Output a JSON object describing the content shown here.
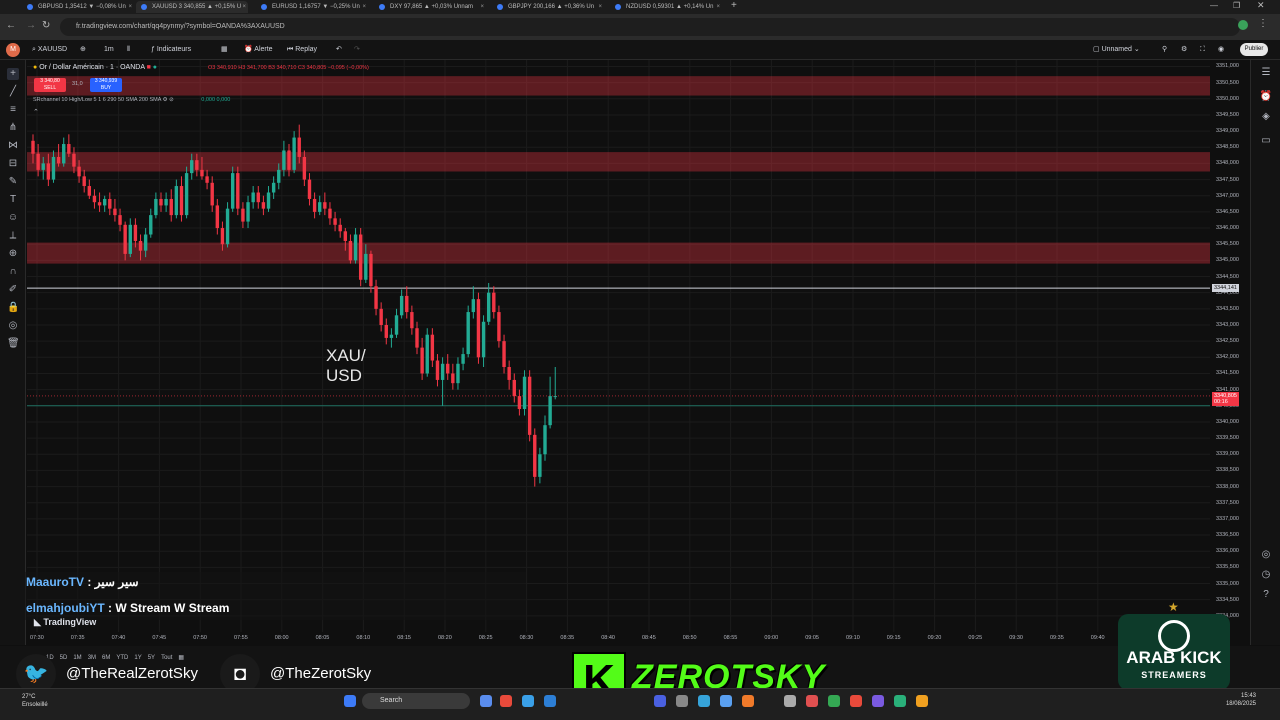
{
  "browser": {
    "tabs": [
      {
        "label": "GBPUSD 1,35412 ▼ −0,08% Un",
        "active": false
      },
      {
        "label": "XAUUSD 3 340,855 ▲ +0,15% U",
        "active": true
      },
      {
        "label": "EURUSD 1,16757 ▼ −0,25% Un",
        "active": false
      },
      {
        "label": "DXY 97,865 ▲ +0,03% Unnam",
        "active": false
      },
      {
        "label": "GBPJPY 200,166 ▲ +0,36% Un",
        "active": false
      },
      {
        "label": "NZDUSD 0,59301 ▲ +0,14% Un",
        "active": false
      }
    ],
    "new_tab": "+",
    "url": "fr.tradingview.com/chart/qq4pynmy/?symbol=OANDA%3AXAUUSD"
  },
  "header": {
    "symbol": "XAUUSD",
    "interval": "1m",
    "indicators": "Indicateurs",
    "alert": "Alerte",
    "replay": "Replay",
    "layout_name": "Unnamed",
    "publish": "Publier"
  },
  "legend": {
    "title": "Or / Dollar Américain · 1 · OANDA",
    "ohlc": "O3 340,910 H3 341,700 B3 340,710 C3 340,805 −0,095 (−0,00%)",
    "sell_price": "3 340,80",
    "sell_label": "SELL",
    "spread": "31,0",
    "buy_price": "3 340,939",
    "buy_label": "BUY",
    "indicator": "SRchannel 10 High/Low 5 1 6 290 50 SMA 200 SMA",
    "indicator_values": "0,000  0,000"
  },
  "overlay_title": {
    "line1": "XAU/",
    "line2": "USD"
  },
  "price_ticks": [
    "3351,000",
    "3350,500",
    "3350,000",
    "3349,500",
    "3349,000",
    "3348,500",
    "3348,000",
    "3347,500",
    "3347,000",
    "3346,500",
    "3346,000",
    "3345,500",
    "3345,000",
    "3344,500",
    "3344,000",
    "3343,500",
    "3343,000",
    "3342,500",
    "3342,000",
    "3341,500",
    "3341,000",
    "3340,500",
    "3340,000",
    "3339,500",
    "3339,000",
    "3338,500",
    "3338,000",
    "3337,500",
    "3337,000",
    "3336,500",
    "3336,000",
    "3335,500",
    "3335,000",
    "3334,500",
    "3334,000"
  ],
  "price_labels": {
    "crosshair": "3344,141",
    "last": "3340,805",
    "countdown": "00:16"
  },
  "time_ticks": [
    "07:30",
    "07:35",
    "07:40",
    "07:45",
    "07:50",
    "07:55",
    "08:00",
    "08:05",
    "08:10",
    "08:15",
    "08:20",
    "08:25",
    "08:30",
    "08:35",
    "08:40",
    "08:45",
    "08:50",
    "08:55",
    "09:00",
    "09:05",
    "09:10",
    "09:15",
    "09:20",
    "09:25",
    "09:30",
    "09:35",
    "09:40"
  ],
  "chart_data": {
    "type": "candlestick",
    "ylim": [
      3333.5,
      3351.2
    ],
    "up_color": "#22ab94",
    "down_color": "#f23645",
    "zones": [
      [
        3350.1,
        3350.7
      ],
      [
        3347.75,
        3348.35
      ],
      [
        3344.9,
        3345.55
      ]
    ],
    "hlines": [
      3344.141,
      3340.5
    ],
    "last_price": 3340.805,
    "candles": [
      [
        3348.7,
        3348.9,
        3348.0,
        3348.3
      ],
      [
        3348.3,
        3348.6,
        3347.6,
        3347.8
      ],
      [
        3347.8,
        3348.2,
        3347.5,
        3348.0
      ],
      [
        3348.0,
        3348.3,
        3347.3,
        3347.5
      ],
      [
        3347.5,
        3348.4,
        3347.4,
        3348.2
      ],
      [
        3348.2,
        3348.6,
        3347.9,
        3348.0
      ],
      [
        3348.0,
        3348.8,
        3347.9,
        3348.6
      ],
      [
        3348.6,
        3348.9,
        3348.2,
        3348.3
      ],
      [
        3348.3,
        3348.5,
        3347.7,
        3347.9
      ],
      [
        3347.9,
        3348.1,
        3347.4,
        3347.6
      ],
      [
        3347.6,
        3347.8,
        3347.1,
        3347.3
      ],
      [
        3347.3,
        3347.5,
        3346.9,
        3347.0
      ],
      [
        3347.0,
        3347.2,
        3346.6,
        3346.8
      ],
      [
        3346.8,
        3347.1,
        3346.5,
        3346.7
      ],
      [
        3346.7,
        3347.0,
        3346.5,
        3346.9
      ],
      [
        3346.9,
        3347.1,
        3346.4,
        3346.6
      ],
      [
        3346.6,
        3346.9,
        3346.2,
        3346.4
      ],
      [
        3346.4,
        3346.6,
        3345.9,
        3346.1
      ],
      [
        3346.1,
        3346.2,
        3345.0,
        3345.2
      ],
      [
        3345.2,
        3346.3,
        3345.1,
        3346.1
      ],
      [
        3346.1,
        3346.3,
        3345.4,
        3345.6
      ],
      [
        3345.6,
        3345.8,
        3345.0,
        3345.3
      ],
      [
        3345.3,
        3346.0,
        3345.1,
        3345.8
      ],
      [
        3345.8,
        3346.6,
        3345.7,
        3346.4
      ],
      [
        3346.4,
        3347.1,
        3346.3,
        3346.9
      ],
      [
        3346.9,
        3347.1,
        3346.5,
        3346.7
      ],
      [
        3346.7,
        3347.1,
        3346.5,
        3346.9
      ],
      [
        3346.9,
        3347.2,
        3346.2,
        3346.4
      ],
      [
        3346.4,
        3347.5,
        3346.3,
        3347.3
      ],
      [
        3347.3,
        3347.6,
        3346.2,
        3346.4
      ],
      [
        3346.4,
        3347.9,
        3346.3,
        3347.7
      ],
      [
        3347.7,
        3348.3,
        3347.5,
        3348.1
      ],
      [
        3348.1,
        3348.3,
        3347.6,
        3347.8
      ],
      [
        3347.8,
        3348.2,
        3347.5,
        3347.6
      ],
      [
        3347.6,
        3347.8,
        3347.2,
        3347.4
      ],
      [
        3347.4,
        3347.6,
        3346.5,
        3346.7
      ],
      [
        3346.7,
        3346.9,
        3345.8,
        3346.0
      ],
      [
        3346.0,
        3346.2,
        3345.3,
        3345.5
      ],
      [
        3345.5,
        3346.8,
        3345.4,
        3346.6
      ],
      [
        3346.6,
        3347.9,
        3346.5,
        3347.7
      ],
      [
        3347.7,
        3347.9,
        3346.4,
        3346.6
      ],
      [
        3346.6,
        3346.8,
        3346.0,
        3346.2
      ],
      [
        3346.2,
        3347.0,
        3346.0,
        3346.8
      ],
      [
        3346.8,
        3347.3,
        3346.6,
        3347.1
      ],
      [
        3347.1,
        3347.3,
        3346.6,
        3346.8
      ],
      [
        3346.8,
        3347.0,
        3346.4,
        3346.6
      ],
      [
        3346.6,
        3347.3,
        3346.5,
        3347.1
      ],
      [
        3347.1,
        3347.6,
        3346.9,
        3347.4
      ],
      [
        3347.4,
        3348.0,
        3347.2,
        3347.8
      ],
      [
        3347.8,
        3348.7,
        3347.6,
        3348.4
      ],
      [
        3348.4,
        3348.6,
        3347.6,
        3347.8
      ],
      [
        3347.8,
        3349.0,
        3347.7,
        3348.8
      ],
      [
        3348.8,
        3349.2,
        3348.0,
        3348.2
      ],
      [
        3348.2,
        3348.4,
        3347.3,
        3347.5
      ],
      [
        3347.5,
        3347.7,
        3346.7,
        3346.9
      ],
      [
        3346.9,
        3347.1,
        3346.3,
        3346.5
      ],
      [
        3346.5,
        3347.0,
        3346.4,
        3346.8
      ],
      [
        3346.8,
        3347.1,
        3346.4,
        3346.6
      ],
      [
        3346.6,
        3346.8,
        3346.1,
        3346.3
      ],
      [
        3346.3,
        3346.5,
        3345.9,
        3346.1
      ],
      [
        3346.1,
        3346.3,
        3345.7,
        3345.9
      ],
      [
        3345.9,
        3346.0,
        3345.3,
        3345.6
      ],
      [
        3345.6,
        3345.8,
        3344.9,
        3345.0
      ],
      [
        3345.0,
        3346.0,
        3344.9,
        3345.8
      ],
      [
        3345.8,
        3346.0,
        3344.2,
        3344.4
      ],
      [
        3344.4,
        3345.5,
        3344.3,
        3345.2
      ],
      [
        3345.2,
        3345.3,
        3344.0,
        3344.2
      ],
      [
        3344.2,
        3344.4,
        3343.3,
        3343.5
      ],
      [
        3343.5,
        3343.7,
        3342.8,
        3343.0
      ],
      [
        3343.0,
        3343.2,
        3342.4,
        3342.6
      ],
      [
        3342.6,
        3342.9,
        3342.3,
        3342.7
      ],
      [
        3342.7,
        3343.5,
        3342.6,
        3343.3
      ],
      [
        3343.3,
        3344.1,
        3343.2,
        3343.9
      ],
      [
        3343.9,
        3344.2,
        3343.2,
        3343.4
      ],
      [
        3343.4,
        3343.6,
        3342.7,
        3342.9
      ],
      [
        3342.9,
        3343.1,
        3342.1,
        3342.3
      ],
      [
        3342.3,
        3342.6,
        3341.3,
        3341.5
      ],
      [
        3341.5,
        3342.9,
        3341.4,
        3342.7
      ],
      [
        3342.7,
        3342.9,
        3341.7,
        3341.9
      ],
      [
        3341.9,
        3342.1,
        3341.1,
        3341.3
      ],
      [
        3341.3,
        3342.0,
        3340.5,
        3341.8
      ],
      [
        3341.8,
        3342.1,
        3341.3,
        3341.5
      ],
      [
        3341.5,
        3341.8,
        3341.0,
        3341.2
      ],
      [
        3341.2,
        3342.0,
        3341.0,
        3341.8
      ],
      [
        3341.8,
        3342.3,
        3341.6,
        3342.1
      ],
      [
        3342.1,
        3343.6,
        3342.0,
        3343.4
      ],
      [
        3343.4,
        3344.2,
        3343.2,
        3343.8
      ],
      [
        3343.8,
        3344.0,
        3341.8,
        3342.0
      ],
      [
        3342.0,
        3343.3,
        3341.7,
        3343.1
      ],
      [
        3343.1,
        3344.3,
        3343.0,
        3344.0
      ],
      [
        3344.0,
        3344.2,
        3343.2,
        3343.4
      ],
      [
        3343.4,
        3343.6,
        3342.3,
        3342.5
      ],
      [
        3342.5,
        3342.7,
        3341.5,
        3341.7
      ],
      [
        3341.7,
        3341.9,
        3341.0,
        3341.3
      ],
      [
        3341.3,
        3341.5,
        3340.6,
        3340.8
      ],
      [
        3340.8,
        3341.0,
        3340.2,
        3340.4
      ],
      [
        3340.4,
        3341.6,
        3340.2,
        3341.4
      ],
      [
        3341.4,
        3341.6,
        3339.4,
        3339.6
      ],
      [
        3339.6,
        3339.8,
        3338.0,
        3338.3
      ],
      [
        3338.3,
        3339.2,
        3338.1,
        3339.0
      ],
      [
        3339.0,
        3340.2,
        3338.8,
        3339.9
      ],
      [
        3339.9,
        3341.4,
        3339.8,
        3340.8
      ],
      [
        3340.8,
        3341.7,
        3340.7,
        3340.8
      ]
    ]
  },
  "chat": [
    {
      "user": "MaauroTV",
      "message": "سير سير"
    },
    {
      "user": "elmahjoubiYT",
      "message": "W Stream W Stream"
    }
  ],
  "tv_watermark": "TradingView",
  "ranges": [
    "1D",
    "5D",
    "1M",
    "3M",
    "6M",
    "YTD",
    "1Y",
    "5Y",
    "Tout"
  ],
  "social": {
    "twitter": "@TheRealZerotSky",
    "instagram": "@TheZerotSky"
  },
  "brand": {
    "kick_letter": "K",
    "name": "ZEROTSKY",
    "badge_line1": "ARAB KICK",
    "badge_line2": "STREAMERS"
  },
  "taskbar": {
    "temp": "27°C",
    "weather": "Ensoleillé",
    "search": "Search",
    "time": "15:43",
    "date": "18/08/2025"
  }
}
